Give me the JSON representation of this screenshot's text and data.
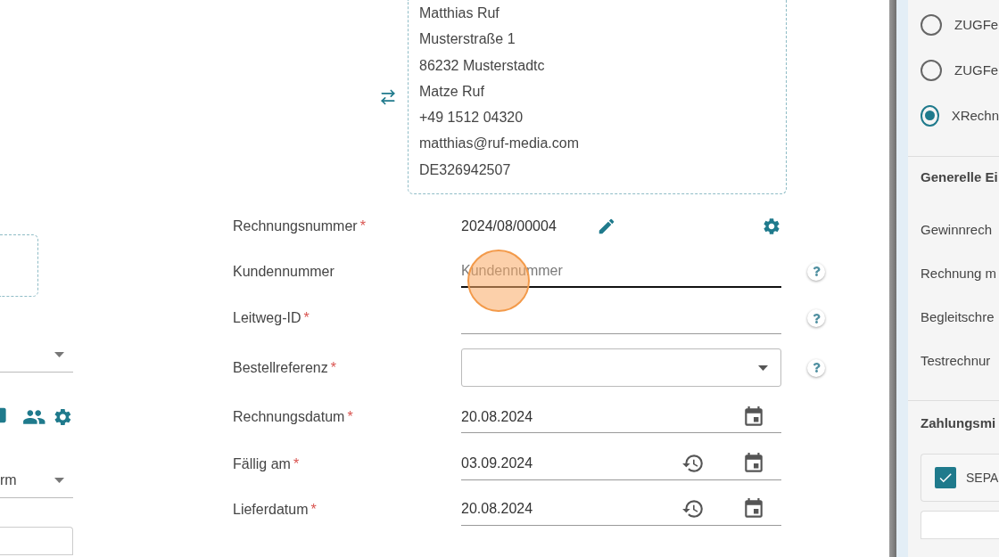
{
  "required_marker": "*",
  "address_card": {
    "lines": [
      "Matthias Ruf",
      "Musterstraße 1",
      "86232 Musterstadtc",
      "Matze Ruf",
      "+49 1512 04320",
      "matthias@ruf-media.com",
      "DE326942507"
    ]
  },
  "left_column": {
    "dropdown_value": "rm"
  },
  "invoice_fields": [
    {
      "kind": "number",
      "label": "Rechnungsnummer",
      "required": true,
      "value": "2024/08/00004",
      "help": false
    },
    {
      "kind": "text",
      "label": "Kundennummer",
      "required": false,
      "placeholder": "Kundennummer",
      "focused": true,
      "help": true,
      "clicked": true
    },
    {
      "kind": "text",
      "label": "Leitweg-ID",
      "required": true,
      "focused": false,
      "help": true,
      "clicked": false
    },
    {
      "kind": "select",
      "label": "Bestellreferenz",
      "required": true,
      "help": true
    },
    {
      "kind": "date",
      "label": "Rechnungsdatum",
      "required": true,
      "value": "20.08.2024",
      "history": false,
      "help": false
    },
    {
      "kind": "date",
      "label": "Fällig am",
      "required": true,
      "value": "03.09.2024",
      "history": true,
      "help": false
    },
    {
      "kind": "date",
      "label": "Lieferdatum",
      "required": true,
      "value": "20.08.2024",
      "history": true,
      "help": false
    }
  ],
  "settings_panel": {
    "formats": [
      {
        "label": "ZUGFe",
        "selected": false
      },
      {
        "label": "ZUGFe",
        "selected": false
      },
      {
        "label": "XRechn",
        "selected": true
      }
    ],
    "general": {
      "title": "Generelle Ei",
      "options": [
        "Gewinnrech",
        "Rechnung m",
        "Begleitschre",
        "Testrechnur"
      ]
    },
    "payment": {
      "title": "Zahlungsmi",
      "methods": [
        {
          "label": "SEPA",
          "checked": true
        }
      ]
    }
  }
}
